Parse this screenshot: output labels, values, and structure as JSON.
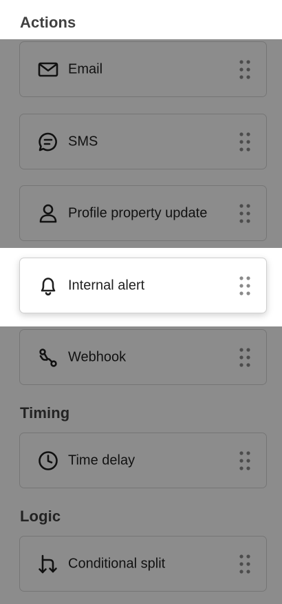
{
  "sections": {
    "actions": {
      "title": "Actions",
      "items": [
        {
          "label": "Email",
          "icon": "envelope-icon"
        },
        {
          "label": "SMS",
          "icon": "chat-bubble-icon"
        },
        {
          "label": "Profile property update",
          "icon": "person-icon"
        },
        {
          "label": "Internal alert",
          "icon": "bell-icon",
          "state": "dragging"
        },
        {
          "label": "Webhook",
          "icon": "webhook-icon"
        }
      ]
    },
    "timing": {
      "title": "Timing",
      "items": [
        {
          "label": "Time delay",
          "icon": "clock-icon"
        }
      ]
    },
    "logic": {
      "title": "Logic",
      "items": [
        {
          "label": "Conditional split",
          "icon": "split-arrows-icon"
        }
      ]
    }
  },
  "overlay_color": "rgba(0,0,0,0.45)"
}
